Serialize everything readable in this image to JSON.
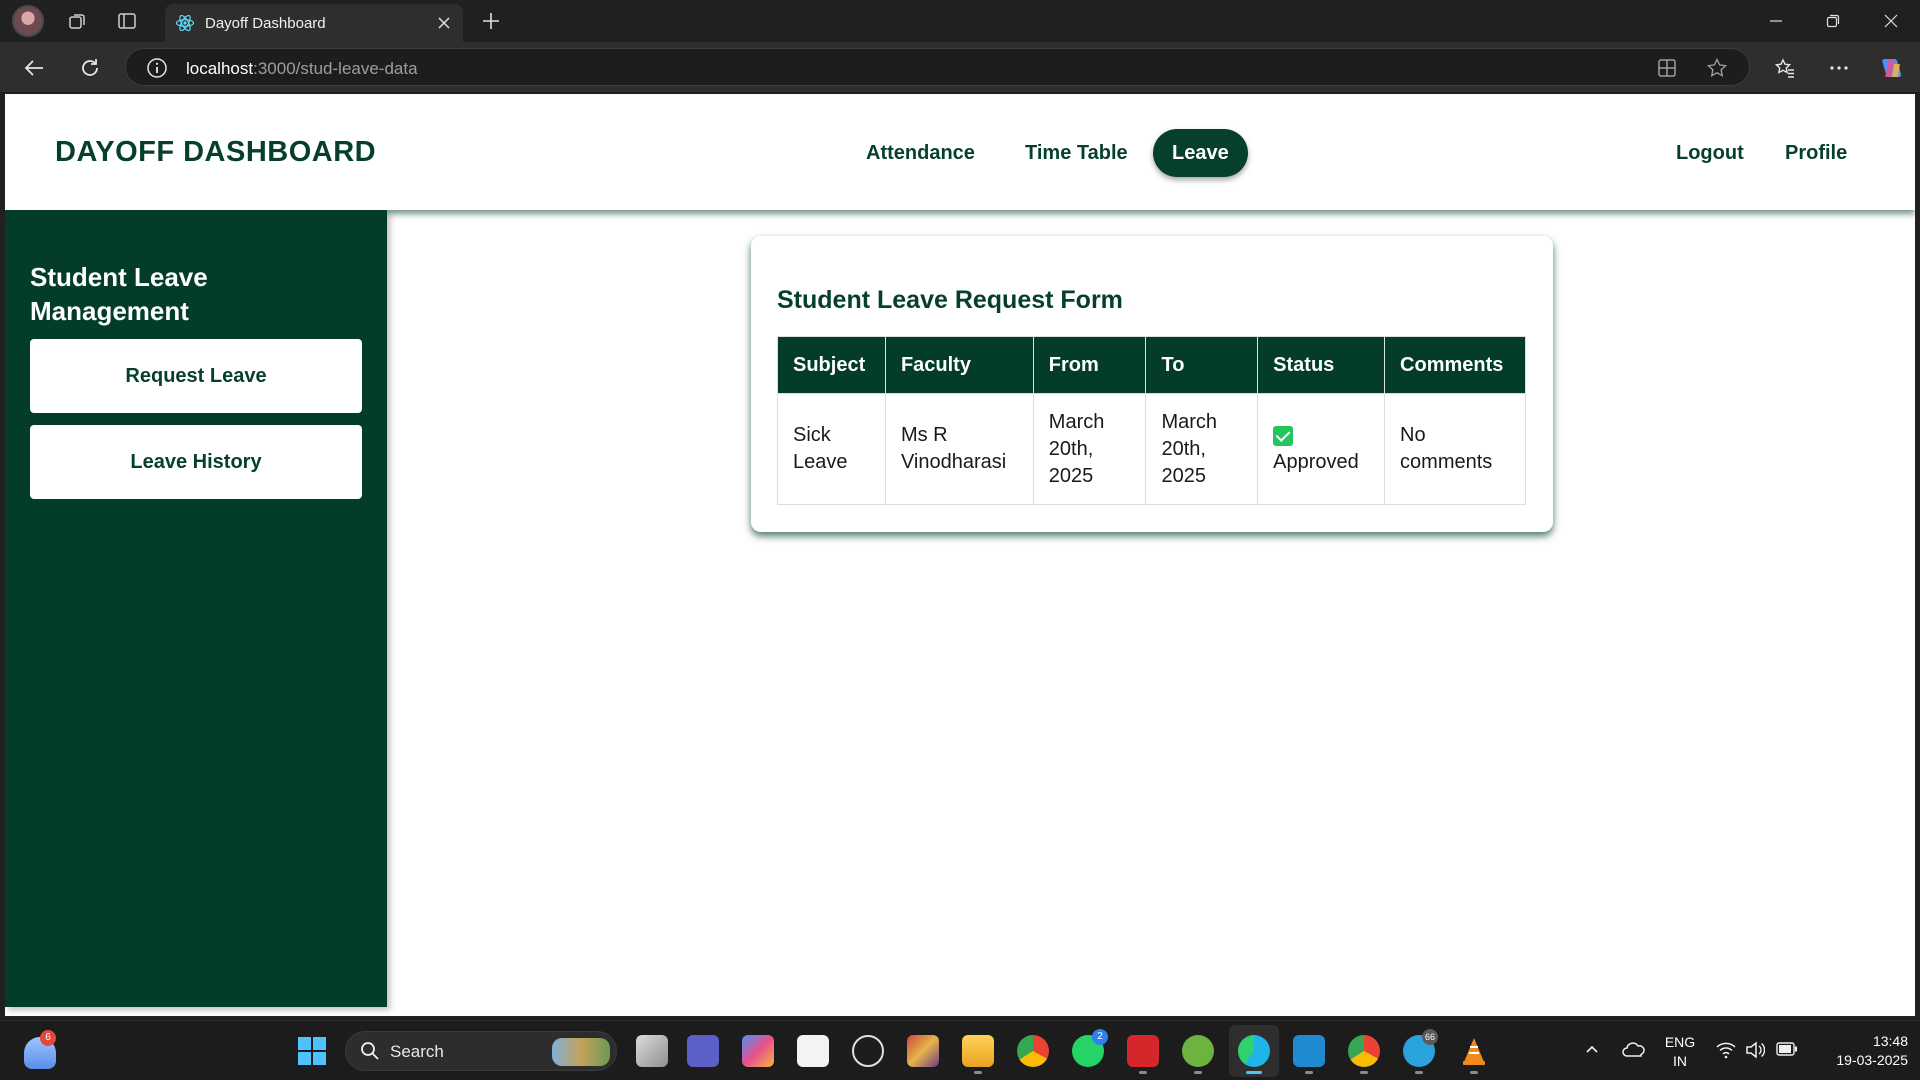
{
  "browser": {
    "tab_title": "Dayoff Dashboard",
    "url_host": "localhost",
    "url_path": ":3000/stud-leave-data"
  },
  "header": {
    "brand": "DAYOFF DASHBOARD",
    "nav": {
      "attendance": "Attendance",
      "timetable": "Time Table",
      "leave": "Leave",
      "logout": "Logout",
      "profile": "Profile"
    },
    "active_nav": "Leave"
  },
  "sidebar": {
    "title": "Student Leave Management",
    "request_leave": "Request Leave",
    "leave_history": "Leave History"
  },
  "card": {
    "title": "Student Leave Request Form",
    "columns": [
      "Subject",
      "Faculty",
      "From",
      "To",
      "Status",
      "Comments"
    ],
    "rows": [
      {
        "subject": "Sick Leave",
        "faculty": "Ms R Vinodharasi",
        "from": "March 20th, 2025",
        "to": "March 20th, 2025",
        "status": "Approved",
        "comments": "No comments"
      }
    ]
  },
  "taskbar": {
    "search_label": "Search",
    "weather_badge": "6",
    "whatsapp_badge": "2",
    "telegram_badge": "66",
    "lang_primary": "ENG",
    "lang_secondary": "IN",
    "time": "13:48",
    "date": "19-03-2025"
  },
  "colors": {
    "brand_green": "#063f2c",
    "sidebar_green": "#033d29",
    "status_check": "#22c55e"
  }
}
